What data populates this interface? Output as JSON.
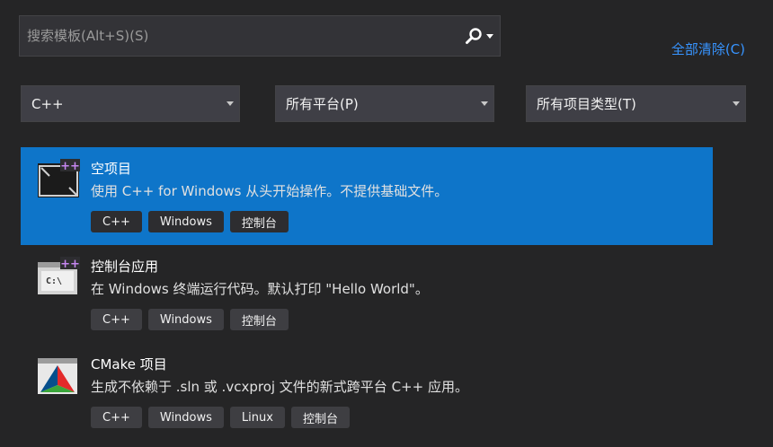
{
  "search": {
    "placeholder": "搜索模板(Alt+S)(S)",
    "value": ""
  },
  "clear_all_label": "全部清除(C)",
  "filters": [
    {
      "label": "C++"
    },
    {
      "label": "所有平台(P)"
    },
    {
      "label": "所有项目类型(T)"
    }
  ],
  "templates": [
    {
      "title": "空项目",
      "description": "使用 C++ for Windows 从头开始操作。不提供基础文件。",
      "tags": [
        "C++",
        "Windows",
        "控制台"
      ],
      "selected": true,
      "icon": "empty-project-icon"
    },
    {
      "title": "控制台应用",
      "description": "在 Windows 终端运行代码。默认打印 \"Hello World\"。",
      "tags": [
        "C++",
        "Windows",
        "控制台"
      ],
      "selected": false,
      "icon": "console-app-icon"
    },
    {
      "title": "CMake 项目",
      "description": "生成不依赖于 .sln 或 .vcxproj 文件的新式跨平台 C++ 应用。",
      "tags": [
        "C++",
        "Windows",
        "Linux",
        "控制台"
      ],
      "selected": false,
      "icon": "cmake-icon"
    }
  ],
  "colors": {
    "background": "#252526",
    "accent": "#0e75c9",
    "link": "#3794ff"
  }
}
